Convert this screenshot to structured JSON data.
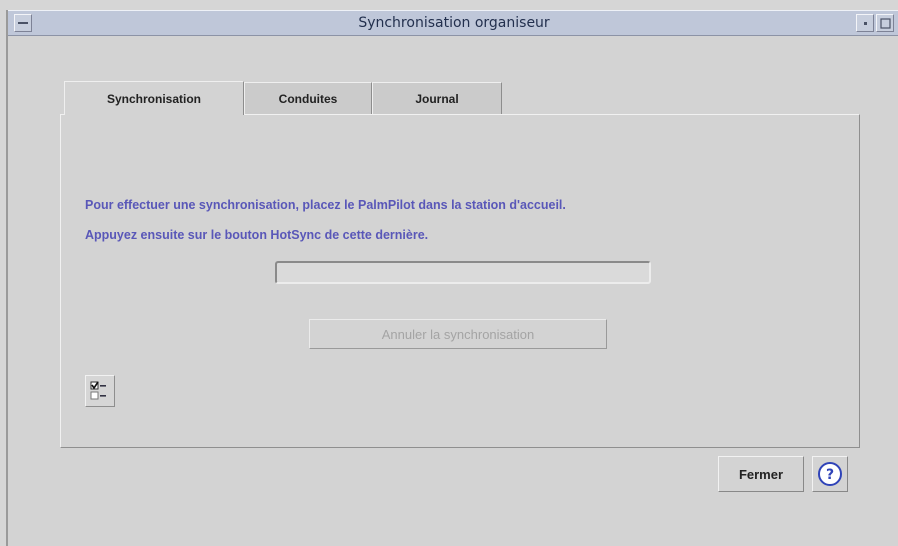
{
  "window": {
    "title": "Synchronisation organiseur",
    "menu_icon": "window-menu-icon",
    "minimize_icon": "minimize-icon",
    "maximize_icon": "maximize-icon"
  },
  "tabs": [
    {
      "label": "Synchronisation",
      "active": true
    },
    {
      "label": "Conduites",
      "active": false
    },
    {
      "label": "Journal",
      "active": false
    }
  ],
  "panel": {
    "message_line1": "Pour effectuer une synchronisation, placez le PalmPilot dans la station d'accueil.",
    "message_line2": "Appuyez ensuite sur le bouton HotSync de cette dernière.",
    "progress_fraction": 0,
    "cancel_label": "Annuler la synchronisation",
    "cancel_enabled": false,
    "options_icon": "checklist-options-icon"
  },
  "footer": {
    "close_label": "Fermer",
    "help_icon": "help-icon"
  },
  "colors": {
    "accent_text": "#5957b8",
    "titlebar": "#bfc7d9",
    "window_bg": "#d3d3d3",
    "disabled_text": "#a4a4a4",
    "help_blue": "#2f43b8"
  }
}
